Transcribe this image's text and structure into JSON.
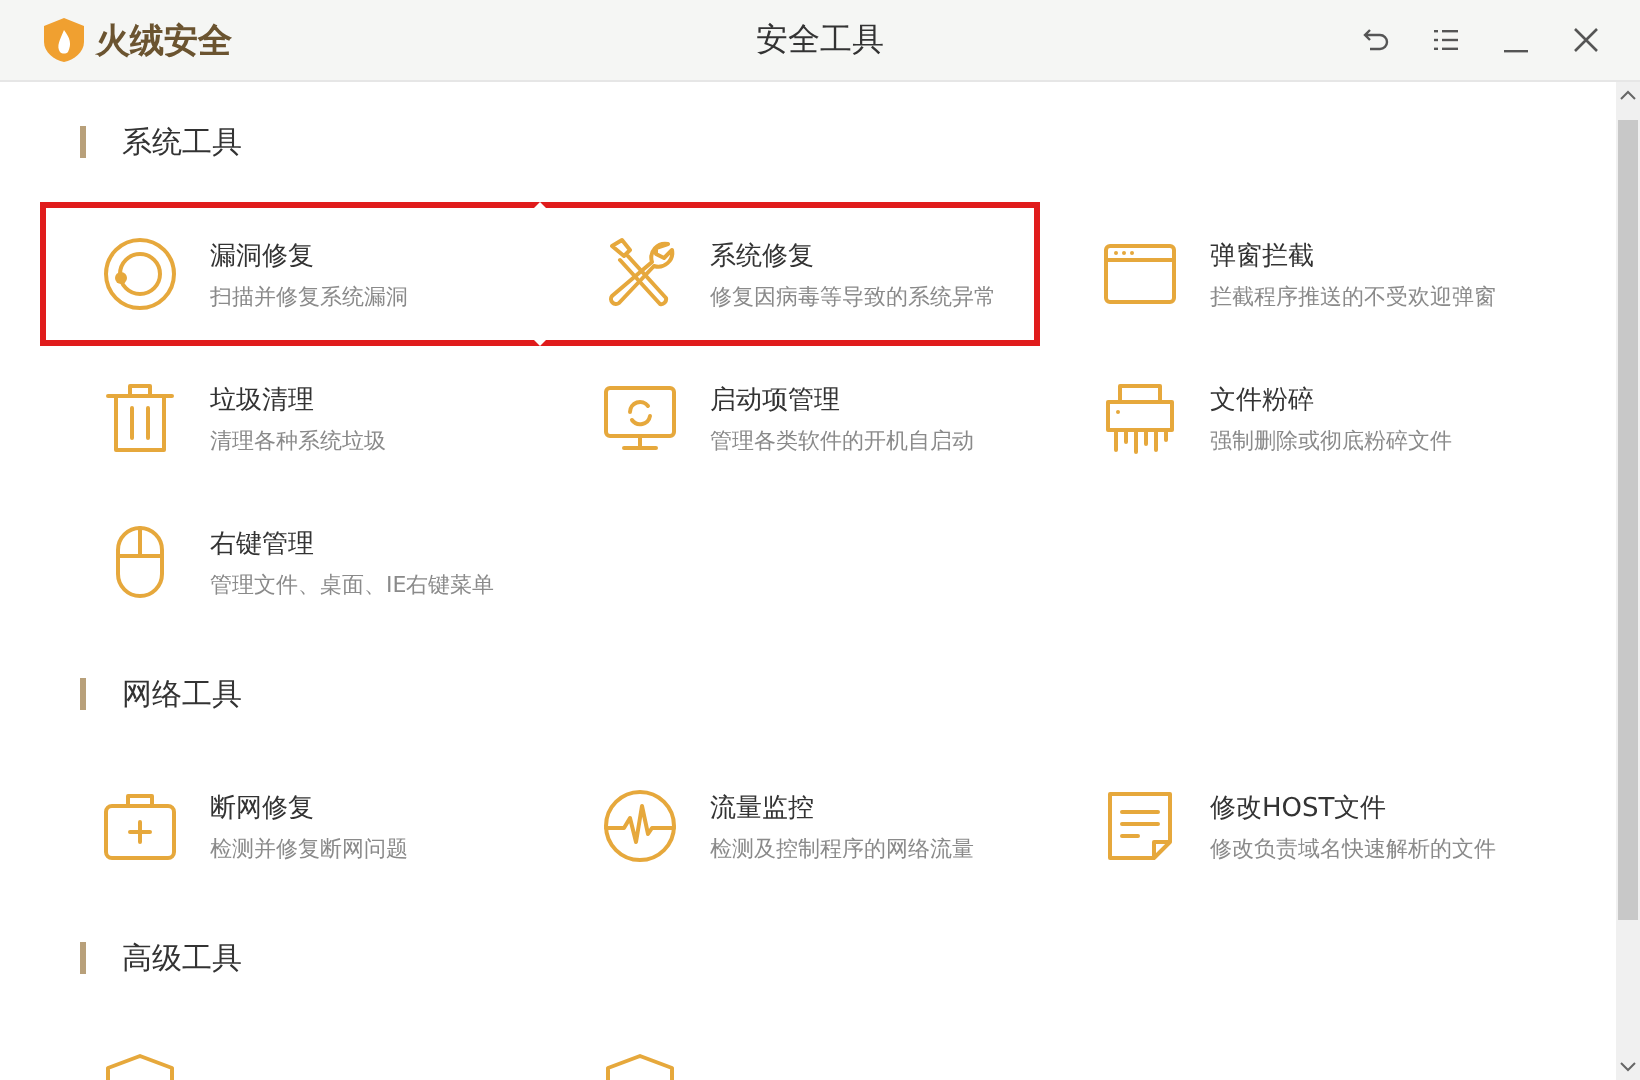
{
  "window": {
    "brand": "火绒安全",
    "title": "安全工具"
  },
  "sections": [
    {
      "title": "系统工具",
      "items": [
        {
          "kind": "lifebuoy",
          "name": "漏洞修复",
          "desc": "扫描并修复系统漏洞",
          "highlighted": true
        },
        {
          "kind": "tools",
          "name": "系统修复",
          "desc": "修复因病毒等导致的系统异常",
          "highlighted": true
        },
        {
          "kind": "window",
          "name": "弹窗拦截",
          "desc": "拦截程序推送的不受欢迎弹窗",
          "highlighted": false
        },
        {
          "kind": "trash",
          "name": "垃圾清理",
          "desc": "清理各种系统垃圾",
          "highlighted": false
        },
        {
          "kind": "monitor",
          "name": "启动项管理",
          "desc": "管理各类软件的开机自启动",
          "highlighted": false
        },
        {
          "kind": "shredder",
          "name": "文件粉碎",
          "desc": "强制删除或彻底粉碎文件",
          "highlighted": false
        },
        {
          "kind": "mouse",
          "name": "右键管理",
          "desc": "管理文件、桌面、IE右键菜单",
          "highlighted": false
        }
      ]
    },
    {
      "title": "网络工具",
      "items": [
        {
          "kind": "kit",
          "name": "断网修复",
          "desc": "检测并修复断网问题",
          "highlighted": false
        },
        {
          "kind": "pulse",
          "name": "流量监控",
          "desc": "检测及控制程序的网络流量",
          "highlighted": false
        },
        {
          "kind": "note",
          "name": "修改HOST文件",
          "desc": "修改负责域名快速解析的文件",
          "highlighted": false
        }
      ]
    },
    {
      "title": "高级工具",
      "items": [
        {
          "kind": "shield",
          "highlighted": false
        },
        {
          "kind": "shield",
          "highlighted": false
        }
      ]
    }
  ]
}
